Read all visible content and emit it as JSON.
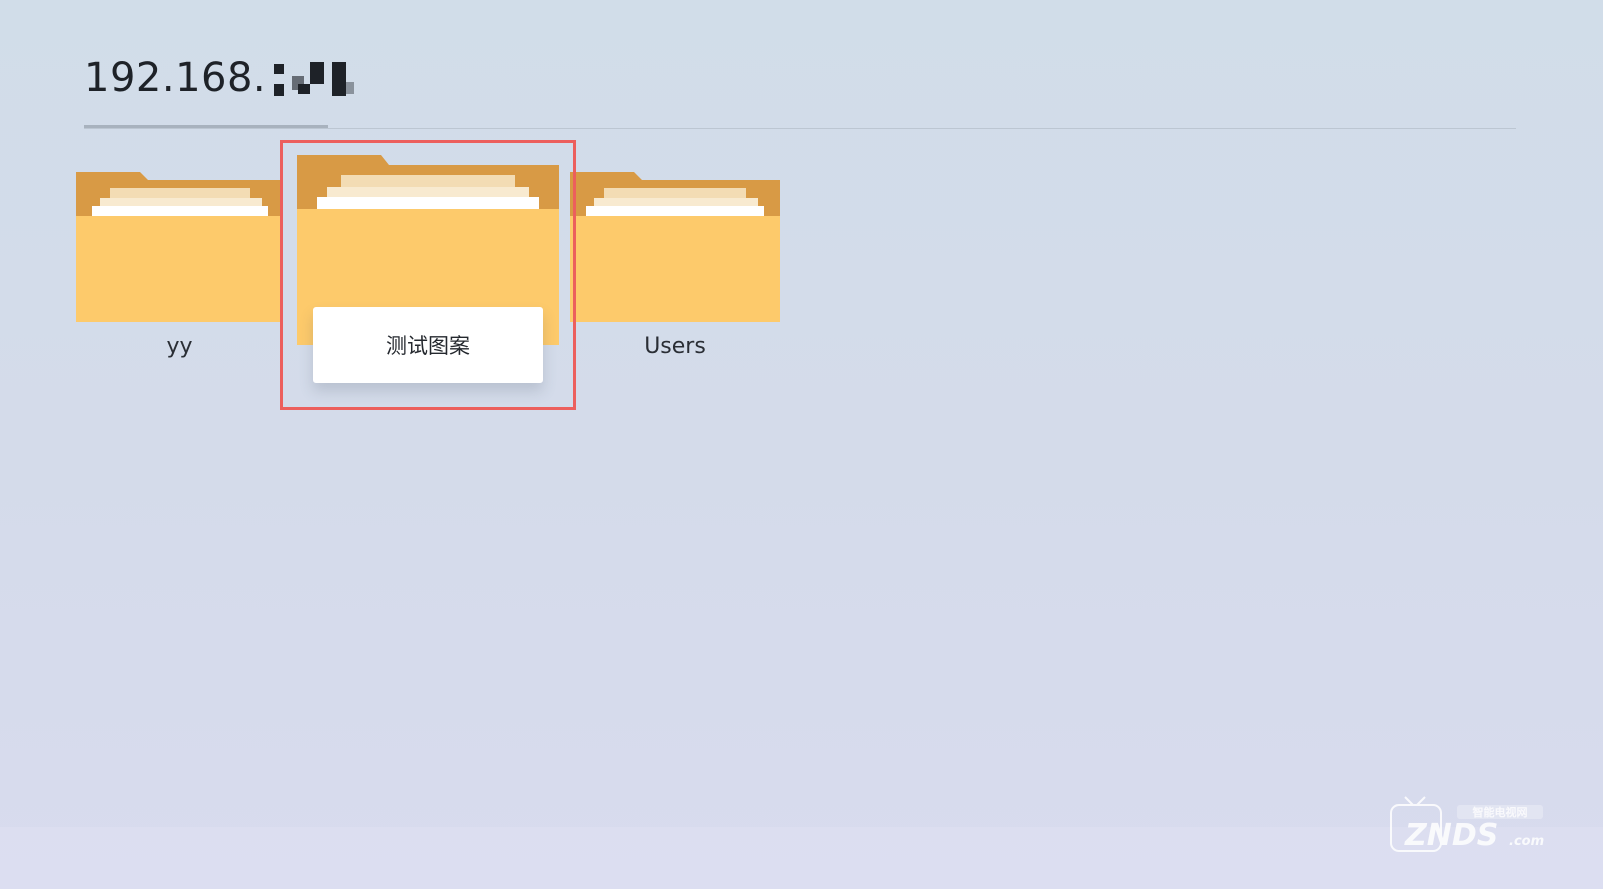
{
  "header": {
    "address_text": "192.168."
  },
  "folders": [
    {
      "name": "yy"
    },
    {
      "name": "测试图案"
    },
    {
      "name": "Users"
    }
  ],
  "watermark": {
    "top_text": "智能电视网",
    "brand_text": "ZNDS",
    "suffix_text": ".com"
  },
  "colors": {
    "folder_back": "#d89a45",
    "folder_front": "#fdca6b",
    "focus_border": "#ec5f5d"
  }
}
